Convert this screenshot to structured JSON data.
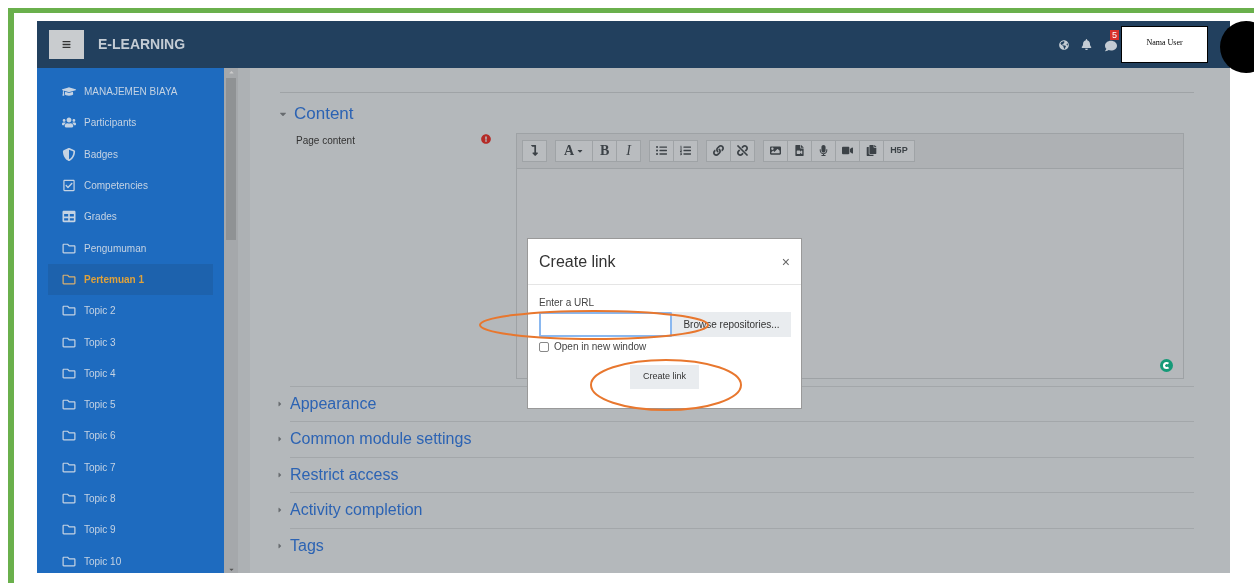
{
  "navbar": {
    "title": "E-LEARNING",
    "notification_count": "5",
    "user_name": "Nama User"
  },
  "sidebar": {
    "items": [
      {
        "label": "MANAJEMEN BIAYA",
        "kind": "course",
        "selected": false
      },
      {
        "label": "Participants",
        "kind": "people",
        "selected": false
      },
      {
        "label": "Badges",
        "kind": "shield",
        "selected": false
      },
      {
        "label": "Competencies",
        "kind": "check",
        "selected": false
      },
      {
        "label": "Grades",
        "kind": "table",
        "selected": false
      },
      {
        "label": "Pengumuman",
        "kind": "folder",
        "selected": false
      },
      {
        "label": "Pertemuan 1",
        "kind": "folder",
        "selected": true
      },
      {
        "label": "Topic 2",
        "kind": "folder",
        "selected": false
      },
      {
        "label": "Topic 3",
        "kind": "folder",
        "selected": false
      },
      {
        "label": "Topic 4",
        "kind": "folder",
        "selected": false
      },
      {
        "label": "Topic 5",
        "kind": "folder",
        "selected": false
      },
      {
        "label": "Topic 6",
        "kind": "folder",
        "selected": false
      },
      {
        "label": "Topic 7",
        "kind": "folder",
        "selected": false
      },
      {
        "label": "Topic 8",
        "kind": "folder",
        "selected": false
      },
      {
        "label": "Topic 9",
        "kind": "folder",
        "selected": false
      },
      {
        "label": "Topic 10",
        "kind": "folder",
        "selected": false
      }
    ]
  },
  "form": {
    "content": {
      "title": "Content",
      "expanded": true,
      "field_label": "Page content",
      "required": true,
      "toolbar": [
        [
          {
            "kind": "collapse"
          }
        ],
        [
          {
            "kind": "font",
            "label": "A"
          },
          {
            "kind": "bold",
            "label": "B"
          },
          {
            "kind": "italic",
            "label": "I"
          }
        ],
        [
          {
            "kind": "bullets"
          },
          {
            "kind": "numbers"
          }
        ],
        [
          {
            "kind": "link"
          },
          {
            "kind": "unlink"
          }
        ],
        [
          {
            "kind": "image"
          },
          {
            "kind": "media"
          },
          {
            "kind": "record-audio"
          },
          {
            "kind": "record-video"
          },
          {
            "kind": "manage-files"
          },
          {
            "kind": "h5p",
            "label": "H5P"
          }
        ]
      ]
    },
    "sections": [
      {
        "title": "Appearance",
        "expanded": false
      },
      {
        "title": "Common module settings",
        "expanded": false
      },
      {
        "title": "Restrict access",
        "expanded": false
      },
      {
        "title": "Activity completion",
        "expanded": false
      },
      {
        "title": "Tags",
        "expanded": false
      }
    ]
  },
  "dialog": {
    "title": "Create link",
    "close": "×",
    "url_label": "Enter a URL",
    "browse_button": "Browse repositories...",
    "new_window": {
      "label": "Open in new window",
      "checked": false
    },
    "submit": "Create link"
  }
}
